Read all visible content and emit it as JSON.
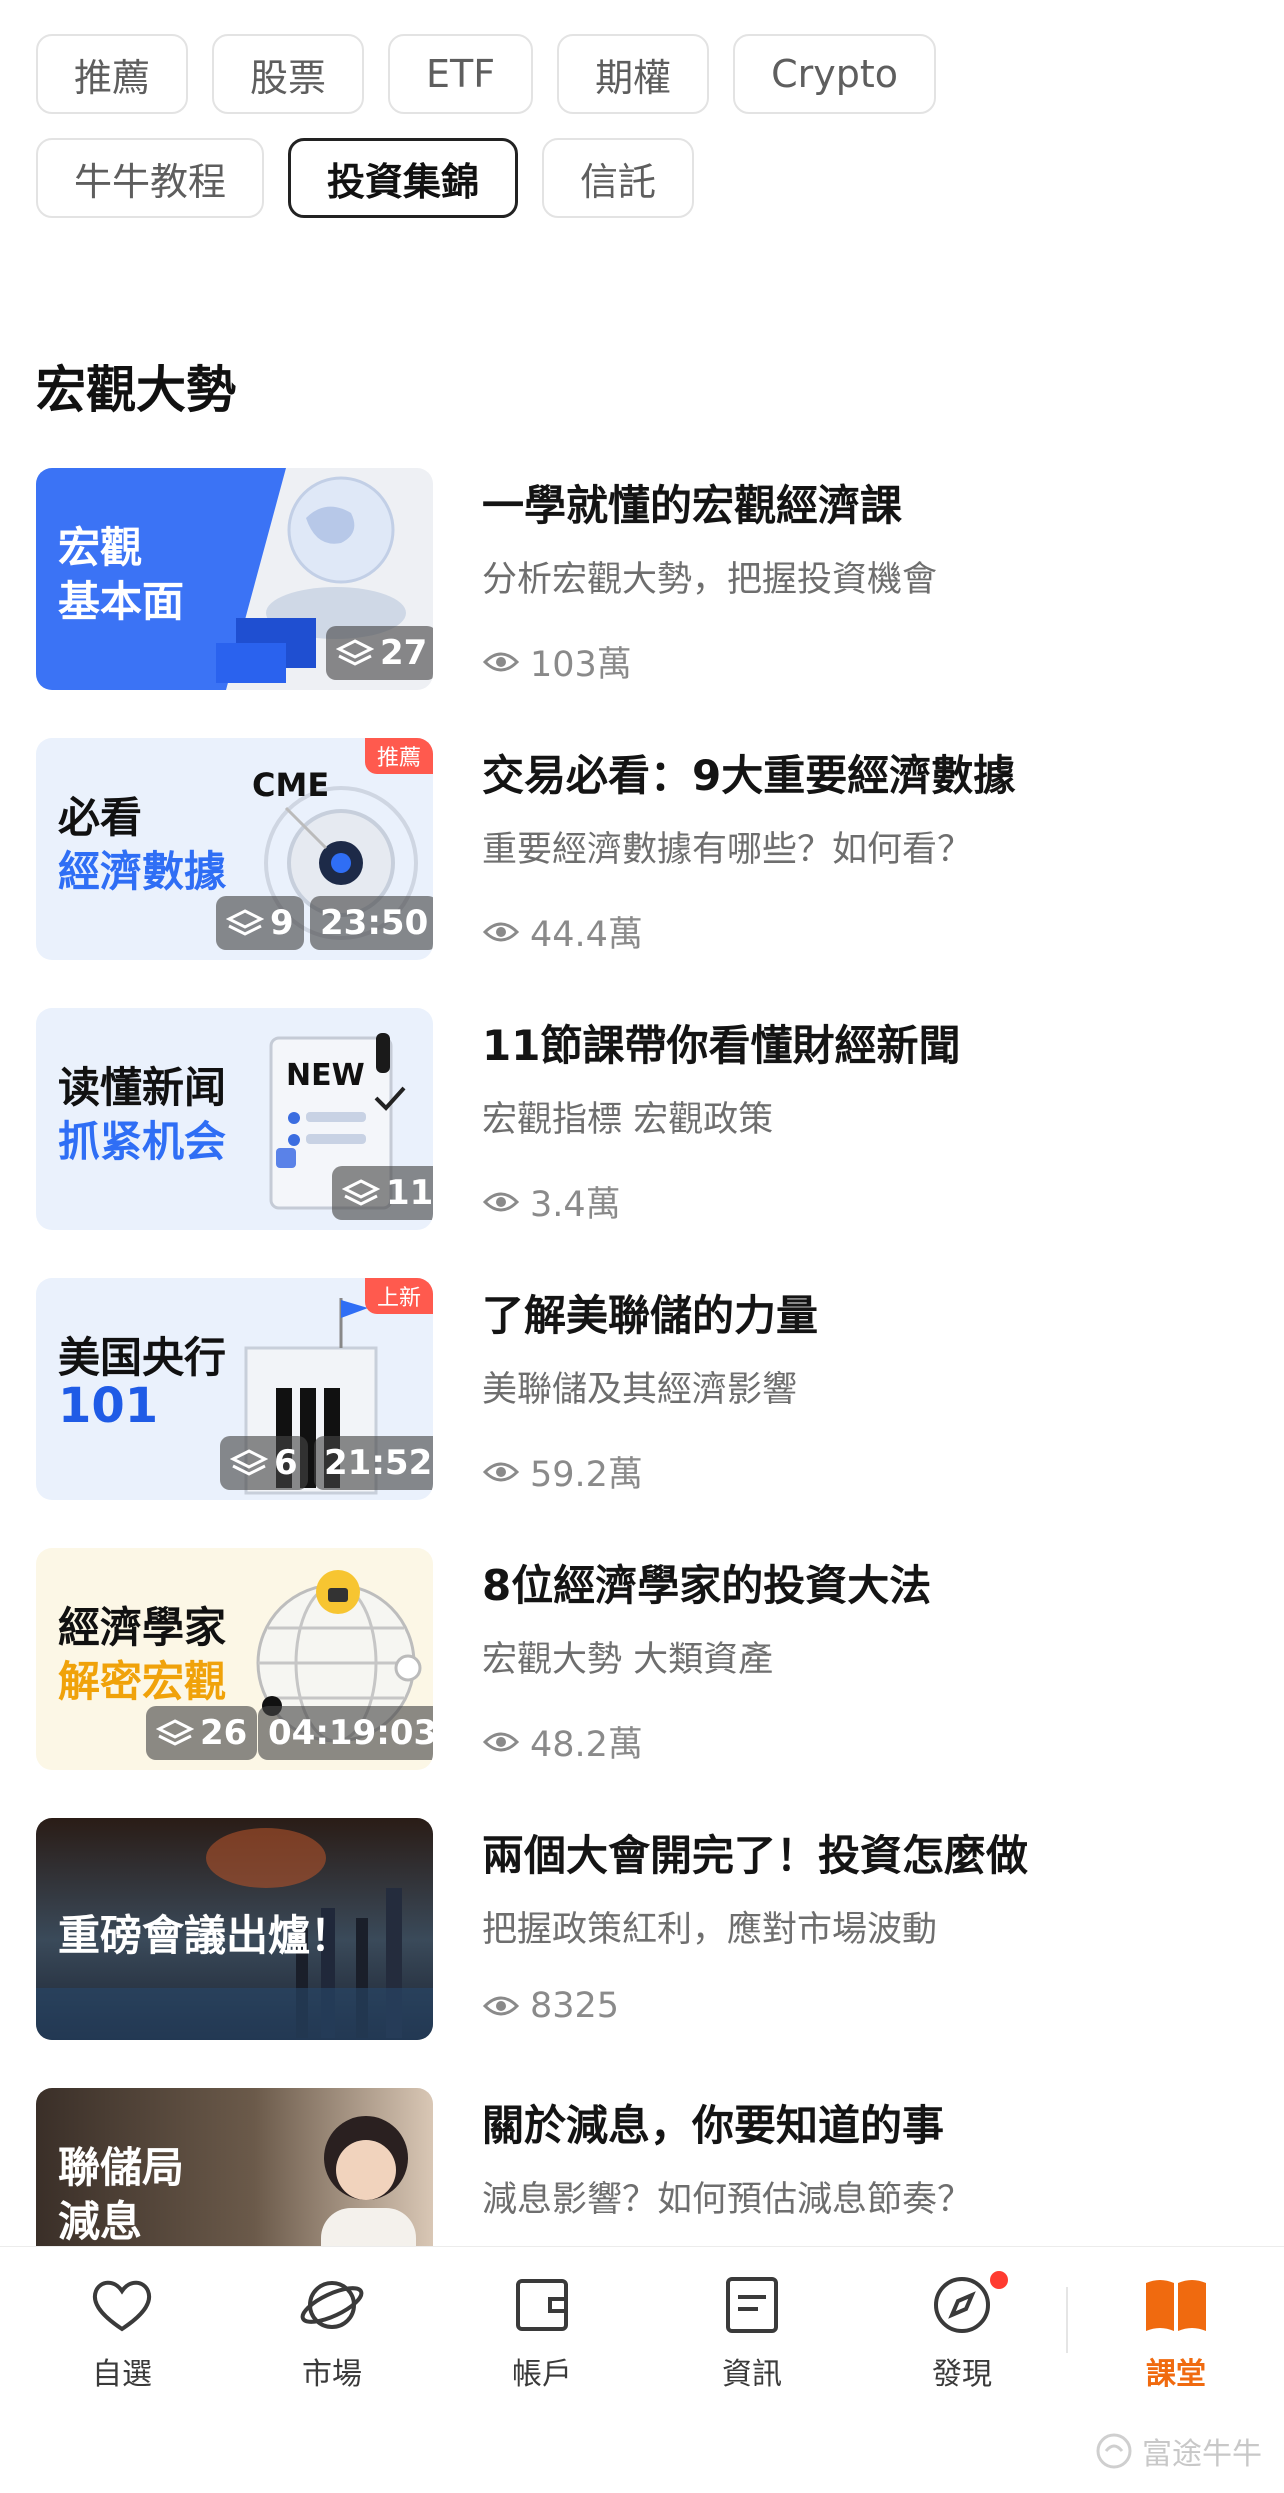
{
  "chips": {
    "row1": [
      "推薦",
      "股票",
      "ETF",
      "期權",
      "Crypto"
    ],
    "row2": [
      "牛牛教程",
      "投資集錦",
      "信託"
    ],
    "active": "投資集錦"
  },
  "section_title": "宏觀大勢",
  "courses": [
    {
      "thumb_line1": "宏觀",
      "thumb_line2": "基本面",
      "tag": "",
      "lessons": "27",
      "duration": "",
      "title": "一學就懂的宏觀經濟課",
      "subtitle": "分析宏觀大勢，把握投資機會",
      "views": "103萬"
    },
    {
      "thumb_line1": "必看",
      "thumb_line2": "經濟數據",
      "thumb_extra": "CME",
      "tag": "推薦",
      "lessons": "9",
      "duration": "23:50",
      "title": "交易必看：9大重要經濟數據",
      "subtitle": "重要經濟數據有哪些？如何看？",
      "views": "44.4萬"
    },
    {
      "thumb_line1": "读懂新闻",
      "thumb_line2": "抓紧机会",
      "thumb_extra": "NEW",
      "tag": "",
      "lessons": "11",
      "duration": "",
      "title": "11節課帶你看懂財經新聞",
      "subtitle": "宏觀指標 宏觀政策",
      "views": "3.4萬"
    },
    {
      "thumb_line1": "美国央行",
      "thumb_line2": "101",
      "tag": "上新",
      "lessons": "6",
      "duration": "21:52",
      "title": "了解美聯儲的力量",
      "subtitle": "美聯儲及其經濟影響",
      "views": "59.2萬"
    },
    {
      "thumb_line1": "經濟學家",
      "thumb_line2": "解密宏觀",
      "tag": "",
      "lessons": "26",
      "duration": "04:19:03",
      "title": "8位經濟學家的投資大法",
      "subtitle": "宏觀大勢 大類資產",
      "views": "48.2萬"
    },
    {
      "thumb_line1": "重磅會議出爐！",
      "thumb_line2": "",
      "tag": "",
      "lessons": "",
      "duration": "",
      "title": "兩個大會開完了！投資怎麼做",
      "subtitle": "把握政策紅利，應對市場波動",
      "views": "8325"
    },
    {
      "thumb_line1": "聯儲局",
      "thumb_line2": "減息",
      "tag": "",
      "lessons": "",
      "duration": "",
      "title": "關於減息，你要知道的事",
      "subtitle": "減息影響？如何預估減息節奏？",
      "views": ""
    }
  ],
  "nav": [
    {
      "label": "自選",
      "icon": "heart-icon"
    },
    {
      "label": "市場",
      "icon": "planet-icon"
    },
    {
      "label": "帳戶",
      "icon": "wallet-icon"
    },
    {
      "label": "資訊",
      "icon": "news-icon"
    },
    {
      "label": "發現",
      "icon": "compass-icon"
    },
    {
      "label": "課堂",
      "icon": "book-icon"
    }
  ],
  "watermark": "富途牛牛",
  "colors": {
    "accent": "#f06a0f",
    "blue_thumb": "#3b73f5",
    "dot": "#ff3b30"
  }
}
